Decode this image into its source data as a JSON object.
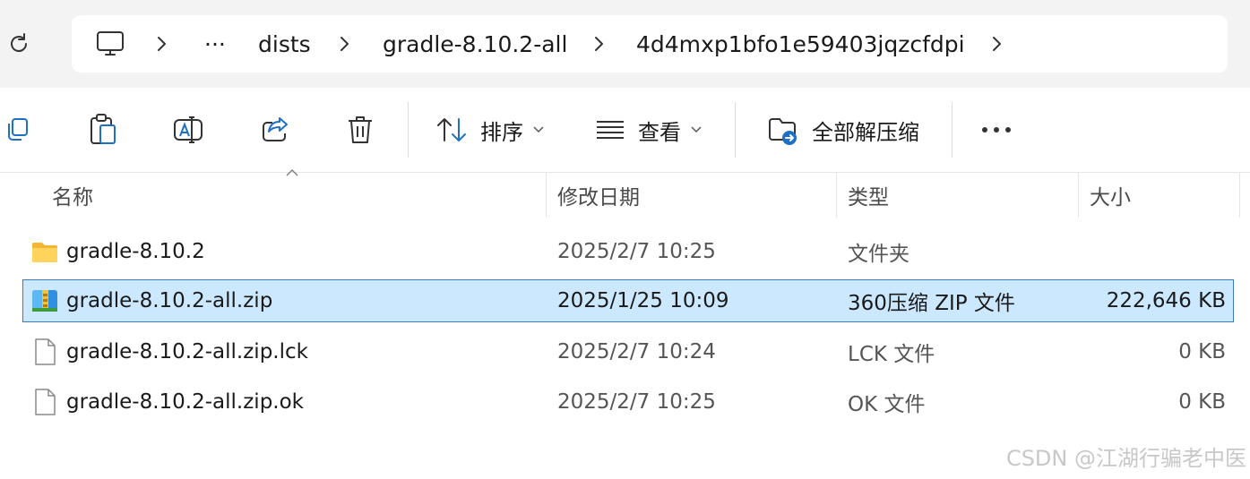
{
  "address_bar": {
    "crumbs": [
      "···",
      "dists",
      "gradle-8.10.2-all",
      "4d4mxp1bfo1e59403jqzcfdpi"
    ]
  },
  "toolbar": {
    "sort_label": "排序",
    "view_label": "查看",
    "extract_label": "全部解压缩"
  },
  "columns": {
    "name": "名称",
    "date": "修改日期",
    "type": "类型",
    "size": "大小"
  },
  "files": [
    {
      "name": "gradle-8.10.2",
      "date": "2025/2/7 10:25",
      "type": "文件夹",
      "size": "",
      "icon": "folder-icon"
    },
    {
      "name": "gradle-8.10.2-all.zip",
      "date": "2025/1/25 10:09",
      "type": "360压缩 ZIP 文件",
      "size": "222,646 KB",
      "icon": "zip-archive-icon",
      "selected": true
    },
    {
      "name": "gradle-8.10.2-all.zip.lck",
      "date": "2025/2/7 10:24",
      "type": "LCK 文件",
      "size": "0 KB",
      "icon": "file-icon"
    },
    {
      "name": "gradle-8.10.2-all.zip.ok",
      "date": "2025/2/7 10:25",
      "type": "OK 文件",
      "size": "0 KB",
      "icon": "file-icon"
    }
  ],
  "watermark": "CSDN @江湖行骗老中医"
}
